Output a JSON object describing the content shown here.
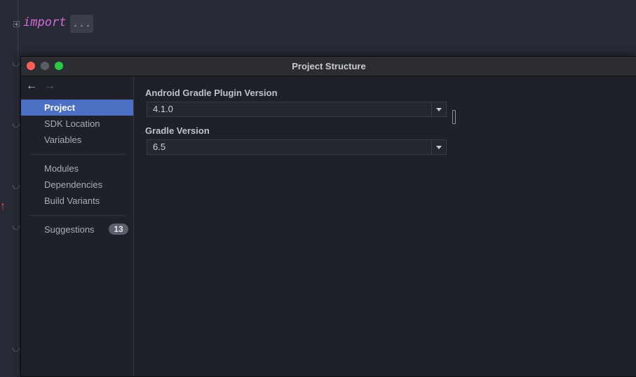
{
  "editor": {
    "keyword": "import",
    "folded_placeholder": "..."
  },
  "dialog": {
    "title": "Project Structure",
    "nav": {
      "back_glyph": "←",
      "forward_glyph": "→"
    },
    "sidebar": {
      "group1": [
        {
          "label": "Project",
          "selected": true
        },
        {
          "label": "SDK Location",
          "selected": false
        },
        {
          "label": "Variables",
          "selected": false
        }
      ],
      "group2": [
        {
          "label": "Modules"
        },
        {
          "label": "Dependencies"
        },
        {
          "label": "Build Variants"
        }
      ],
      "suggestions": {
        "label": "Suggestions",
        "count": "13"
      }
    },
    "content": {
      "agp_label": "Android Gradle Plugin Version",
      "agp_value": "4.1.0",
      "gradle_label": "Gradle Version",
      "gradle_value": "6.5"
    }
  },
  "colors": {
    "accent_selected": "#4a6fc3",
    "close": "#fd5f57",
    "maximize": "#2ac941",
    "keyword": "#d26ad8"
  },
  "icons": [
    "plus-fold-icon",
    "fold-marker-icon",
    "up-arrow-marker-icon",
    "back-arrow-icon",
    "forward-arrow-icon",
    "chevron-down-icon"
  ]
}
